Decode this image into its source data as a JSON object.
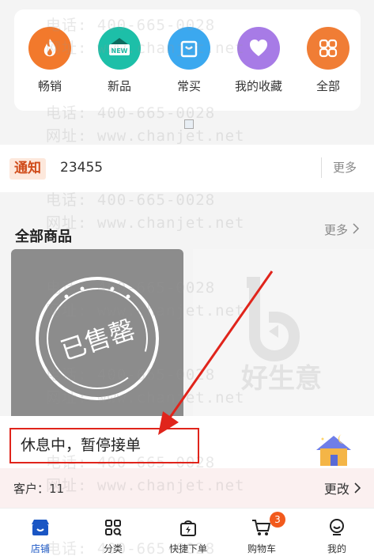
{
  "watermark": {
    "phone": "电话: 400-665-0028",
    "site": "网址: www.chanjet.net"
  },
  "categories": [
    {
      "label": "畅销",
      "icon": "fire-icon",
      "color": "#f2792c"
    },
    {
      "label": "新品",
      "icon": "new-tag-icon",
      "color": "#1dbfa8"
    },
    {
      "label": "常买",
      "icon": "shopping-bag-icon",
      "color": "#3ba8ef"
    },
    {
      "label": "我的收藏",
      "icon": "heart-icon",
      "color": "#a77be6"
    },
    {
      "label": "全部",
      "icon": "grid-icon",
      "color": "#f07d35"
    }
  ],
  "notice": {
    "tag": "通知",
    "text": "23455",
    "more": "更多"
  },
  "all_products": {
    "title": "全部商品",
    "more": "更多",
    "sold_out_stamp": "已售罄",
    "placeholder_logo": "好生意"
  },
  "rest_banner": {
    "text": "休息中，暂停接单"
  },
  "customer": {
    "label": "客户：",
    "value": "11",
    "change": "更改"
  },
  "tabs": [
    {
      "label": "店铺",
      "icon": "shop-icon",
      "active": true
    },
    {
      "label": "分类",
      "icon": "category-icon",
      "active": false
    },
    {
      "label": "快捷下单",
      "icon": "quick-order-icon",
      "active": false
    },
    {
      "label": "购物车",
      "icon": "cart-icon",
      "active": false,
      "badge": "3"
    },
    {
      "label": "我的",
      "icon": "profile-icon",
      "active": false
    }
  ]
}
